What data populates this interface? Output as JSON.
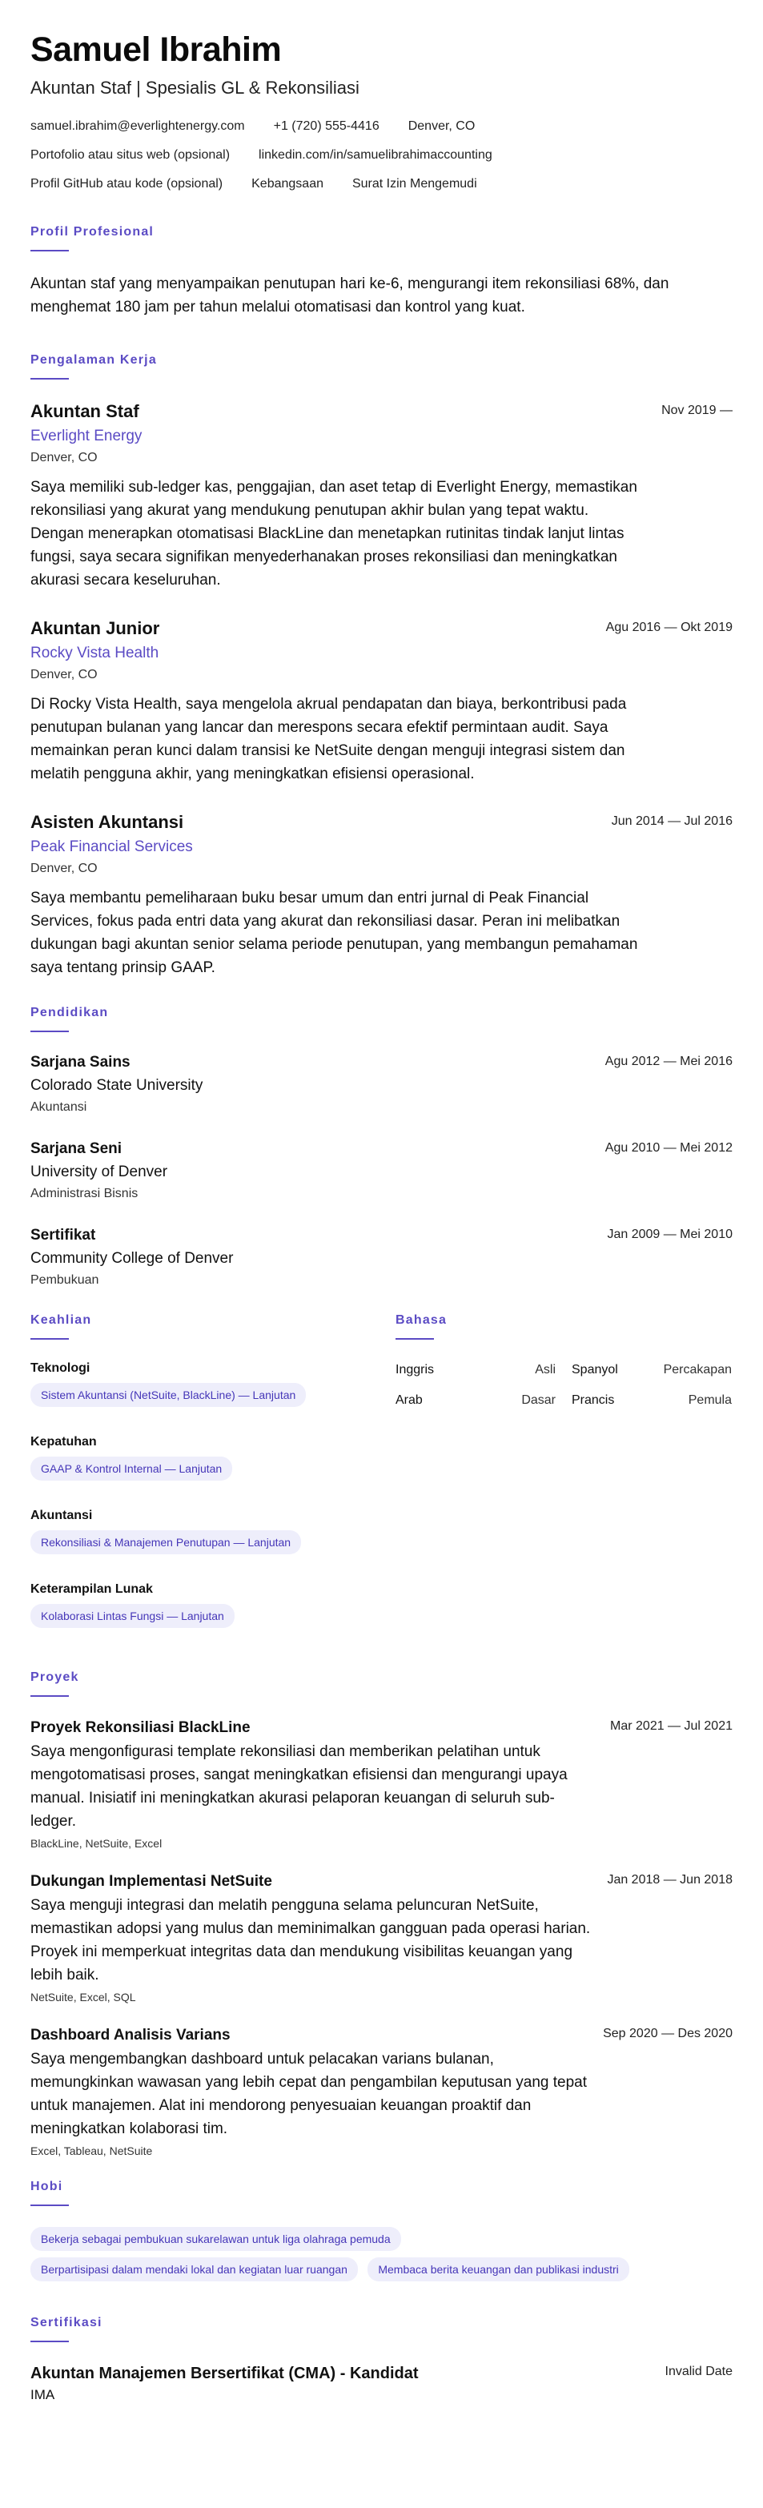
{
  "header": {
    "name": "Samuel Ibrahim",
    "tagline": "Akuntan Staf | Spesialis GL & Rekonsiliasi",
    "contact_rows": [
      [
        "samuel.ibrahim@everlightenergy.com",
        "+1 (720) 555-4416",
        "Denver, CO"
      ],
      [
        "Portofolio atau situs web (opsional)",
        "linkedin.com/in/samuelibrahimaccounting"
      ],
      [
        "Profil GitHub atau kode (opsional)",
        "Kebangsaan",
        "Surat Izin Mengemudi"
      ]
    ]
  },
  "summary": {
    "title": "Profil Profesional",
    "text": "Akuntan staf yang menyampaikan penutupan hari ke-6, mengurangi item rekonsiliasi 68%, dan menghemat 180 jam per tahun melalui otomatisasi dan kontrol yang kuat."
  },
  "experience": {
    "title": "Pengalaman Kerja",
    "jobs": [
      {
        "title": "Akuntan Staf",
        "date": "Nov 2019 —",
        "company": "Everlight Energy",
        "location": "Denver, CO",
        "desc": "Saya memiliki sub-ledger kas, penggajian, dan aset tetap di Everlight Energy, memastikan rekonsiliasi yang akurat yang mendukung penutupan akhir bulan yang tepat waktu. Dengan menerapkan otomatisasi BlackLine dan menetapkan rutinitas tindak lanjut lintas fungsi, saya secara signifikan menyederhanakan proses rekonsiliasi dan meningkatkan akurasi secara keseluruhan."
      },
      {
        "title": "Akuntan Junior",
        "date": "Agu 2016 — Okt 2019",
        "company": "Rocky Vista Health",
        "location": "Denver, CO",
        "desc": "Di Rocky Vista Health, saya mengelola akrual pendapatan dan biaya, berkontribusi pada penutupan bulanan yang lancar dan merespons secara efektif permintaan audit. Saya memainkan peran kunci dalam transisi ke NetSuite dengan menguji integrasi sistem dan melatih pengguna akhir, yang meningkatkan efisiensi operasional."
      },
      {
        "title": "Asisten Akuntansi",
        "date": "Jun 2014 — Jul 2016",
        "company": "Peak Financial Services",
        "location": "Denver, CO",
        "desc": "Saya membantu pemeliharaan buku besar umum dan entri jurnal di Peak Financial Services, fokus pada entri data yang akurat dan rekonsiliasi dasar. Peran ini melibatkan dukungan bagi akuntan senior selama periode penutupan, yang membangun pemahaman saya tentang prinsip GAAP."
      }
    ]
  },
  "education": {
    "title": "Pendidikan",
    "items": [
      {
        "degree": "Sarjana Sains",
        "date": "Agu 2012 — Mei 2016",
        "school": "Colorado State University",
        "field": "Akuntansi"
      },
      {
        "degree": "Sarjana Seni",
        "date": "Agu 2010 — Mei 2012",
        "school": "University of Denver",
        "field": "Administrasi Bisnis"
      },
      {
        "degree": "Sertifikat",
        "date": "Jan 2009 — Mei 2010",
        "school": "Community College of Denver",
        "field": "Pembukuan"
      }
    ]
  },
  "skills": {
    "title": "Keahlian",
    "groups": [
      {
        "category": "Teknologi",
        "chips": [
          "Sistem Akuntansi (NetSuite, BlackLine) — Lanjutan"
        ]
      },
      {
        "category": "Kepatuhan",
        "chips": [
          "GAAP & Kontrol Internal — Lanjutan"
        ]
      },
      {
        "category": "Akuntansi",
        "chips": [
          "Rekonsiliasi & Manajemen Penutupan — Lanjutan"
        ]
      },
      {
        "category": "Keterampilan Lunak",
        "chips": [
          "Kolaborasi Lintas Fungsi — Lanjutan"
        ]
      }
    ]
  },
  "languages": {
    "title": "Bahasa",
    "items": [
      {
        "name": "Inggris",
        "level": "Asli"
      },
      {
        "name": "Spanyol",
        "level": "Percakapan"
      },
      {
        "name": "Arab",
        "level": "Dasar"
      },
      {
        "name": "Prancis",
        "level": "Pemula"
      }
    ]
  },
  "projects": {
    "title": "Proyek",
    "items": [
      {
        "title": "Proyek Rekonsiliasi BlackLine",
        "date": "Mar 2021 — Jul 2021",
        "desc": "Saya mengonfigurasi template rekonsiliasi dan memberikan pelatihan untuk mengotomatisasi proses, sangat meningkatkan efisiensi dan mengurangi upaya manual. Inisiatif ini meningkatkan akurasi pelaporan keuangan di seluruh sub-ledger.",
        "tech": "BlackLine, NetSuite, Excel"
      },
      {
        "title": "Dukungan Implementasi NetSuite",
        "date": "Jan 2018 — Jun 2018",
        "desc": "Saya menguji integrasi dan melatih pengguna selama peluncuran NetSuite, memastikan adopsi yang mulus dan meminimalkan gangguan pada operasi harian. Proyek ini memperkuat integritas data dan mendukung visibilitas keuangan yang lebih baik.",
        "tech": "NetSuite, Excel, SQL"
      },
      {
        "title": "Dashboard Analisis Varians",
        "date": "Sep 2020 — Des 2020",
        "desc": "Saya mengembangkan dashboard untuk pelacakan varians bulanan, memungkinkan wawasan yang lebih cepat dan pengambilan keputusan yang tepat untuk manajemen. Alat ini mendorong penyesuaian keuangan proaktif dan meningkatkan kolaborasi tim.",
        "tech": "Excel, Tableau, NetSuite"
      }
    ]
  },
  "hobbies": {
    "title": "Hobi",
    "chips": [
      "Bekerja sebagai pembukuan sukarelawan untuk liga olahraga pemuda",
      "Berpartisipasi dalam mendaki lokal dan kegiatan luar ruangan",
      "Membaca berita keuangan dan publikasi industri"
    ]
  },
  "certifications": {
    "title": "Sertifikasi",
    "items": [
      {
        "title": "Akuntan Manajemen Bersertifikat (CMA) - Kandidat",
        "date": "Invalid Date",
        "issuer": "IMA"
      }
    ]
  },
  "colors": {
    "accent": "#5b4bc4",
    "chip_bg": "#eeeefb",
    "text": "#111111"
  }
}
